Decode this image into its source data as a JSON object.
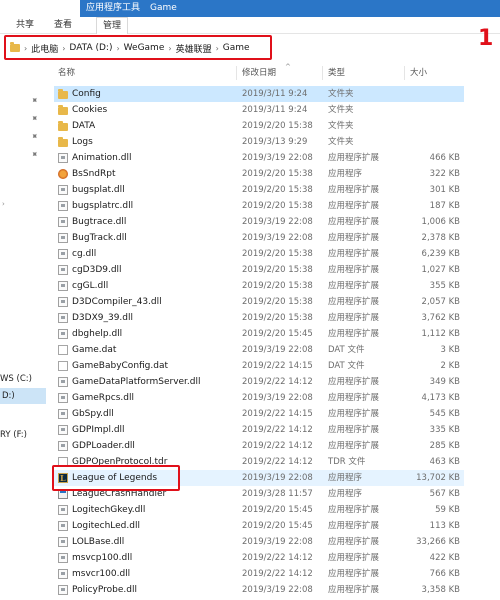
{
  "ribbon": {
    "context_tab": "应用程序工具",
    "window_title": "Game",
    "tabs": [
      "共享",
      "查看",
      "管理"
    ]
  },
  "address": {
    "crumbs": [
      "此电脑",
      "DATA (D:)",
      "WeGame",
      "英雄联盟",
      "Game"
    ]
  },
  "annotation_number": "1",
  "columns": {
    "name": "名称",
    "date": "修改日期",
    "type": "类型",
    "size": "大小"
  },
  "nav": {
    "drives": [
      {
        "label": "WS (C:)"
      },
      {
        "label": "D:)"
      },
      {
        "label": "RY (F:)"
      }
    ]
  },
  "files": [
    {
      "name": "Config",
      "date": "2019/3/11 9:24",
      "type": "文件夹",
      "size": "",
      "icon": "folder-icon"
    },
    {
      "name": "Cookies",
      "date": "2019/3/11 9:24",
      "type": "文件夹",
      "size": "",
      "icon": "folder-icon"
    },
    {
      "name": "DATA",
      "date": "2019/2/20 15:38",
      "type": "文件夹",
      "size": "",
      "icon": "folder-icon"
    },
    {
      "name": "Logs",
      "date": "2019/3/13 9:29",
      "type": "文件夹",
      "size": "",
      "icon": "folder-icon"
    },
    {
      "name": "Animation.dll",
      "date": "2019/3/19 22:08",
      "type": "应用程序扩展",
      "size": "466 KB",
      "icon": "dll-icon"
    },
    {
      "name": "BsSndRpt",
      "date": "2019/2/20 15:38",
      "type": "应用程序",
      "size": "322 KB",
      "icon": "bugsplat-app-icon"
    },
    {
      "name": "bugsplat.dll",
      "date": "2019/2/20 15:38",
      "type": "应用程序扩展",
      "size": "301 KB",
      "icon": "dll-icon"
    },
    {
      "name": "bugsplatrc.dll",
      "date": "2019/2/20 15:38",
      "type": "应用程序扩展",
      "size": "187 KB",
      "icon": "dll-icon"
    },
    {
      "name": "Bugtrace.dll",
      "date": "2019/3/19 22:08",
      "type": "应用程序扩展",
      "size": "1,006 KB",
      "icon": "dll-icon"
    },
    {
      "name": "BugTrack.dll",
      "date": "2019/3/19 22:08",
      "type": "应用程序扩展",
      "size": "2,378 KB",
      "icon": "dll-icon"
    },
    {
      "name": "cg.dll",
      "date": "2019/2/20 15:38",
      "type": "应用程序扩展",
      "size": "6,239 KB",
      "icon": "dll-icon"
    },
    {
      "name": "cgD3D9.dll",
      "date": "2019/2/20 15:38",
      "type": "应用程序扩展",
      "size": "1,027 KB",
      "icon": "dll-icon"
    },
    {
      "name": "cgGL.dll",
      "date": "2019/2/20 15:38",
      "type": "应用程序扩展",
      "size": "355 KB",
      "icon": "dll-icon"
    },
    {
      "name": "D3DCompiler_43.dll",
      "date": "2019/2/20 15:38",
      "type": "应用程序扩展",
      "size": "2,057 KB",
      "icon": "dll-icon"
    },
    {
      "name": "D3DX9_39.dll",
      "date": "2019/2/20 15:38",
      "type": "应用程序扩展",
      "size": "3,762 KB",
      "icon": "dll-icon"
    },
    {
      "name": "dbghelp.dll",
      "date": "2019/2/20 15:45",
      "type": "应用程序扩展",
      "size": "1,112 KB",
      "icon": "dll-icon"
    },
    {
      "name": "Game.dat",
      "date": "2019/3/19 22:08",
      "type": "DAT 文件",
      "size": "3 KB",
      "icon": "file-icon"
    },
    {
      "name": "GameBabyConfig.dat",
      "date": "2019/2/22 14:15",
      "type": "DAT 文件",
      "size": "2 KB",
      "icon": "file-icon"
    },
    {
      "name": "GameDataPlatformServer.dll",
      "date": "2019/2/22 14:12",
      "type": "应用程序扩展",
      "size": "349 KB",
      "icon": "dll-icon"
    },
    {
      "name": "GameRpcs.dll",
      "date": "2019/3/19 22:08",
      "type": "应用程序扩展",
      "size": "4,173 KB",
      "icon": "dll-icon"
    },
    {
      "name": "GbSpy.dll",
      "date": "2019/2/22 14:15",
      "type": "应用程序扩展",
      "size": "545 KB",
      "icon": "dll-icon"
    },
    {
      "name": "GDPImpl.dll",
      "date": "2019/2/22 14:12",
      "type": "应用程序扩展",
      "size": "335 KB",
      "icon": "dll-icon"
    },
    {
      "name": "GDPLoader.dll",
      "date": "2019/2/22 14:12",
      "type": "应用程序扩展",
      "size": "285 KB",
      "icon": "dll-icon"
    },
    {
      "name": "GDPOpenProtocol.tdr",
      "date": "2019/2/22 14:12",
      "type": "TDR 文件",
      "size": "463 KB",
      "icon": "file-icon"
    },
    {
      "name": "League of Legends",
      "date": "2019/3/19 22:08",
      "type": "应用程序",
      "size": "13,702 KB",
      "icon": "league-of-legends-icon"
    },
    {
      "name": "LeagueCrashHandler",
      "date": "2019/3/28 11:57",
      "type": "应用程序",
      "size": "567 KB",
      "icon": "exe-icon"
    },
    {
      "name": "LogitechGkey.dll",
      "date": "2019/2/20 15:45",
      "type": "应用程序扩展",
      "size": "59 KB",
      "icon": "dll-icon"
    },
    {
      "name": "LogitechLed.dll",
      "date": "2019/2/20 15:45",
      "type": "应用程序扩展",
      "size": "113 KB",
      "icon": "dll-icon"
    },
    {
      "name": "LOLBase.dll",
      "date": "2019/3/19 22:08",
      "type": "应用程序扩展",
      "size": "33,266 KB",
      "icon": "dll-icon"
    },
    {
      "name": "msvcp100.dll",
      "date": "2019/2/22 14:12",
      "type": "应用程序扩展",
      "size": "422 KB",
      "icon": "dll-icon"
    },
    {
      "name": "msvcr100.dll",
      "date": "2019/2/22 14:12",
      "type": "应用程序扩展",
      "size": "766 KB",
      "icon": "dll-icon"
    },
    {
      "name": "PolicyProbe.dll",
      "date": "2019/3/19 22:08",
      "type": "应用程序扩展",
      "size": "3,358 KB",
      "icon": "dll-icon"
    }
  ],
  "selected_file": "Config",
  "highlighted_file": "League of Legends"
}
